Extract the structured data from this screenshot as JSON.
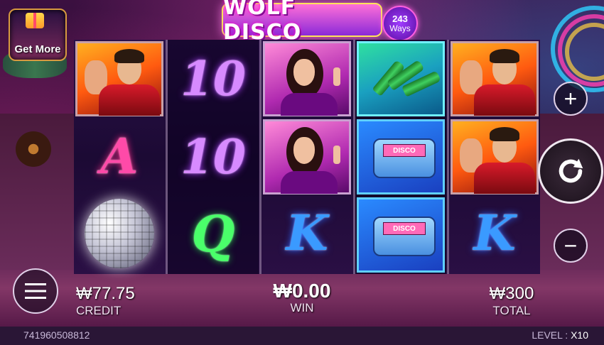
{
  "game": {
    "logo_title": "WOLF DISCO",
    "ways_count": "243",
    "ways_label": "Ways"
  },
  "promo": {
    "get_more_label": "Get More"
  },
  "reels": [
    [
      "man-jacket-symbol",
      "a-symbol",
      "disco-ball-symbol"
    ],
    [
      "10-symbol",
      "10-symbol",
      "q-symbol"
    ],
    [
      "woman-symbol",
      "woman-symbol",
      "k-symbol"
    ],
    [
      "bottles-symbol",
      "disco-pager-symbol",
      "disco-pager-symbol"
    ],
    [
      "man-jacket-symbol",
      "man-jacket-symbol",
      "k-symbol"
    ]
  ],
  "symbols": {
    "ten": "10",
    "a": "A",
    "q": "Q",
    "k": "K",
    "pager_screen": "DISCO"
  },
  "controls": {
    "plus": "+",
    "minus": "−"
  },
  "stats": {
    "credit_value": "₩77.75",
    "credit_label": "CREDIT",
    "win_value": "₩0.00",
    "win_label": "WIN",
    "total_value": "₩300",
    "total_label": "TOTAL"
  },
  "footer": {
    "round_id": "741960508812",
    "level_label": "LEVEL :",
    "level_value": "X10"
  },
  "colors": {
    "accent_pink": "#ff4aa8",
    "accent_purple": "#d78aff",
    "accent_green": "#4aff6a",
    "accent_blue": "#3a9aff"
  }
}
